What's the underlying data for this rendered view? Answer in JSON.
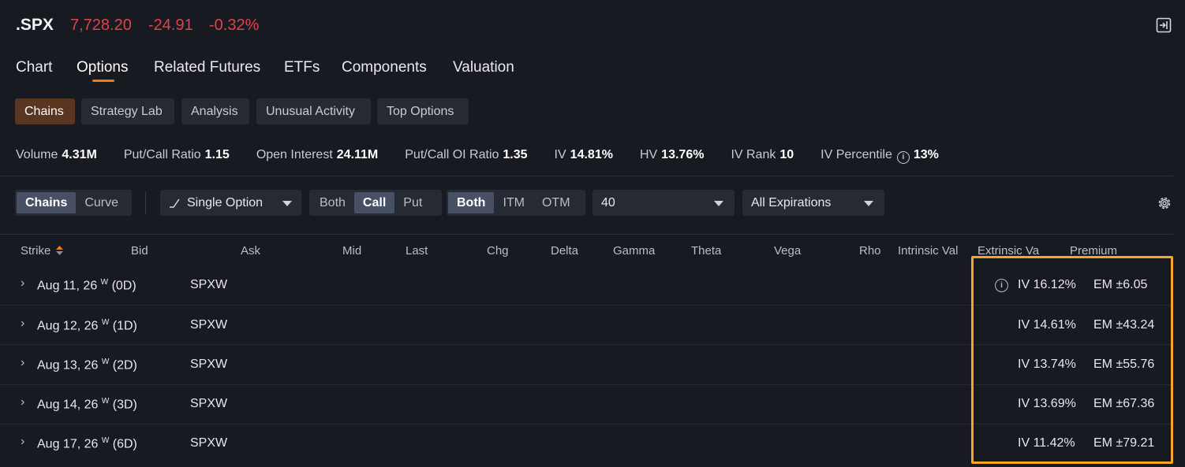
{
  "header": {
    "ticker": ".SPX",
    "price": "7,728.20",
    "change": "-24.91",
    "change_pct": "-0.32%",
    "price_color": "#e0424c"
  },
  "nav_tabs": [
    {
      "label": "Chart",
      "active": false
    },
    {
      "label": "Options",
      "active": true
    },
    {
      "label": "Related Futures",
      "active": false
    },
    {
      "label": "ETFs",
      "active": false
    },
    {
      "label": "Components",
      "active": false
    },
    {
      "label": "Valuation",
      "active": false
    }
  ],
  "sub_tabs": [
    {
      "label": "Chains",
      "active": true
    },
    {
      "label": "Strategy Lab",
      "active": false
    },
    {
      "label": "Analysis",
      "active": false
    },
    {
      "label": "Unusual Activity",
      "active": false
    },
    {
      "label": "Top Options",
      "active": false
    }
  ],
  "stats": [
    {
      "label": "Volume",
      "value": "4.31M"
    },
    {
      "label": "Put/Call Ratio",
      "value": "1.15"
    },
    {
      "label": "Open Interest",
      "value": "24.11M"
    },
    {
      "label": "Put/Call OI Ratio",
      "value": "1.35"
    },
    {
      "label": "IV",
      "value": "14.81%"
    },
    {
      "label": "HV",
      "value": "13.76%"
    },
    {
      "label": "IV Rank",
      "value": "10"
    },
    {
      "label": "IV Percentile",
      "value": "13%"
    }
  ],
  "controls": {
    "view_toggle": [
      "Chains",
      "Curve"
    ],
    "strategy": "Single Option",
    "side_toggle": [
      "Both",
      "Call",
      "Put"
    ],
    "money_toggle": [
      "Both",
      "ITM",
      "OTM"
    ],
    "strikes": "40",
    "expirations": "All Expirations"
  },
  "columns": [
    "Strike",
    "Bid",
    "Ask",
    "Mid",
    "Last",
    "Chg",
    "Delta",
    "Gamma",
    "Theta",
    "Vega",
    "Rho",
    "Intrinsic Val",
    "Extrinsic Va",
    "Premium"
  ],
  "rows": [
    {
      "date": "Aug 11, 26",
      "sup": "W",
      "dte": "(0D)",
      "root": "SPXW",
      "iv": "IV 16.12%",
      "em": "EM ±6.05"
    },
    {
      "date": "Aug 12, 26",
      "sup": "W",
      "dte": "(1D)",
      "root": "SPXW",
      "iv": "IV 14.61%",
      "em": "EM ±43.24"
    },
    {
      "date": "Aug 13, 26",
      "sup": "W",
      "dte": "(2D)",
      "root": "SPXW",
      "iv": "IV 13.74%",
      "em": "EM ±55.76"
    },
    {
      "date": "Aug 14, 26",
      "sup": "W",
      "dte": "(3D)",
      "root": "SPXW",
      "iv": "IV 13.69%",
      "em": "EM ±67.36"
    },
    {
      "date": "Aug 17, 26",
      "sup": "W",
      "dte": "(6D)",
      "root": "SPXW",
      "iv": "IV 11.42%",
      "em": "EM ±79.21"
    }
  ],
  "colors": {
    "accent": "#f07a1c",
    "highlight": "#f5a623",
    "background": "#171a21"
  }
}
